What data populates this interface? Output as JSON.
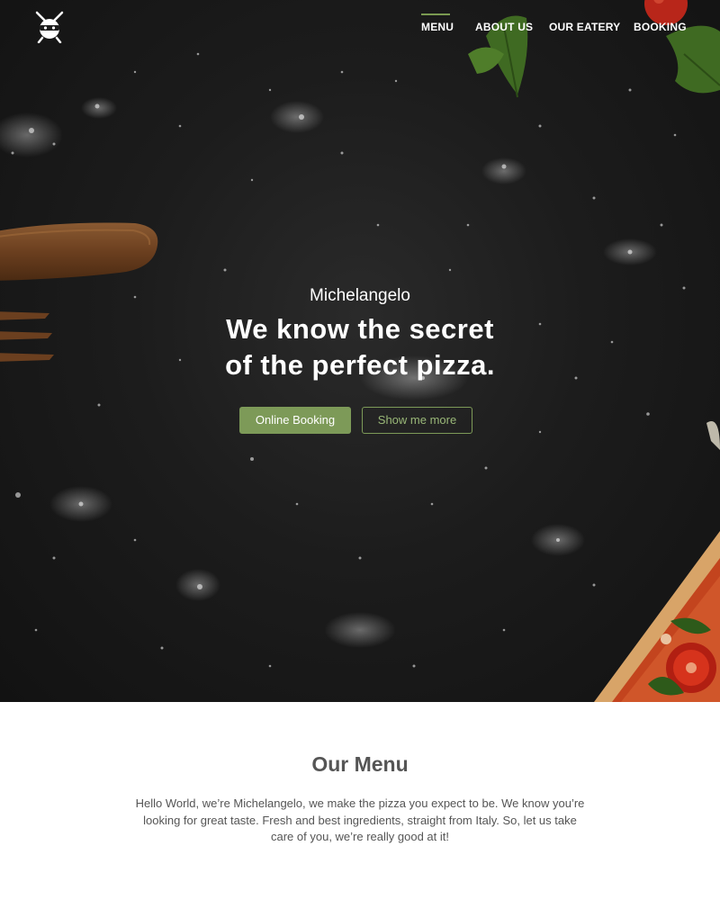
{
  "nav": {
    "items": [
      {
        "label": "MENU",
        "active": true
      },
      {
        "label": "ABOUT US",
        "active": false
      },
      {
        "label": "OUR EATERY",
        "active": false
      },
      {
        "label": "BOOKING",
        "active": false
      }
    ],
    "accent_color": "#7a9a50"
  },
  "hero": {
    "subtitle": "Michelangelo",
    "title_line1": "We know the secret",
    "title_line2": "of the perfect pizza.",
    "primary_button": "Online Booking",
    "secondary_button": "Show me more"
  },
  "menu_section": {
    "title": "Our Menu",
    "text": "Hello World, we’re Michelangelo, we make the pizza you expect to be. We know you’re looking for great taste. Fresh and best ingredients, straight from Italy. So, let us take care of you, we’re really good at it!"
  },
  "icons": {
    "logo": "pizza-ninja-logo-icon"
  },
  "colors": {
    "accent": "#7d9a58",
    "hero_bg": "#1c1c1c",
    "body_text": "#555555"
  }
}
